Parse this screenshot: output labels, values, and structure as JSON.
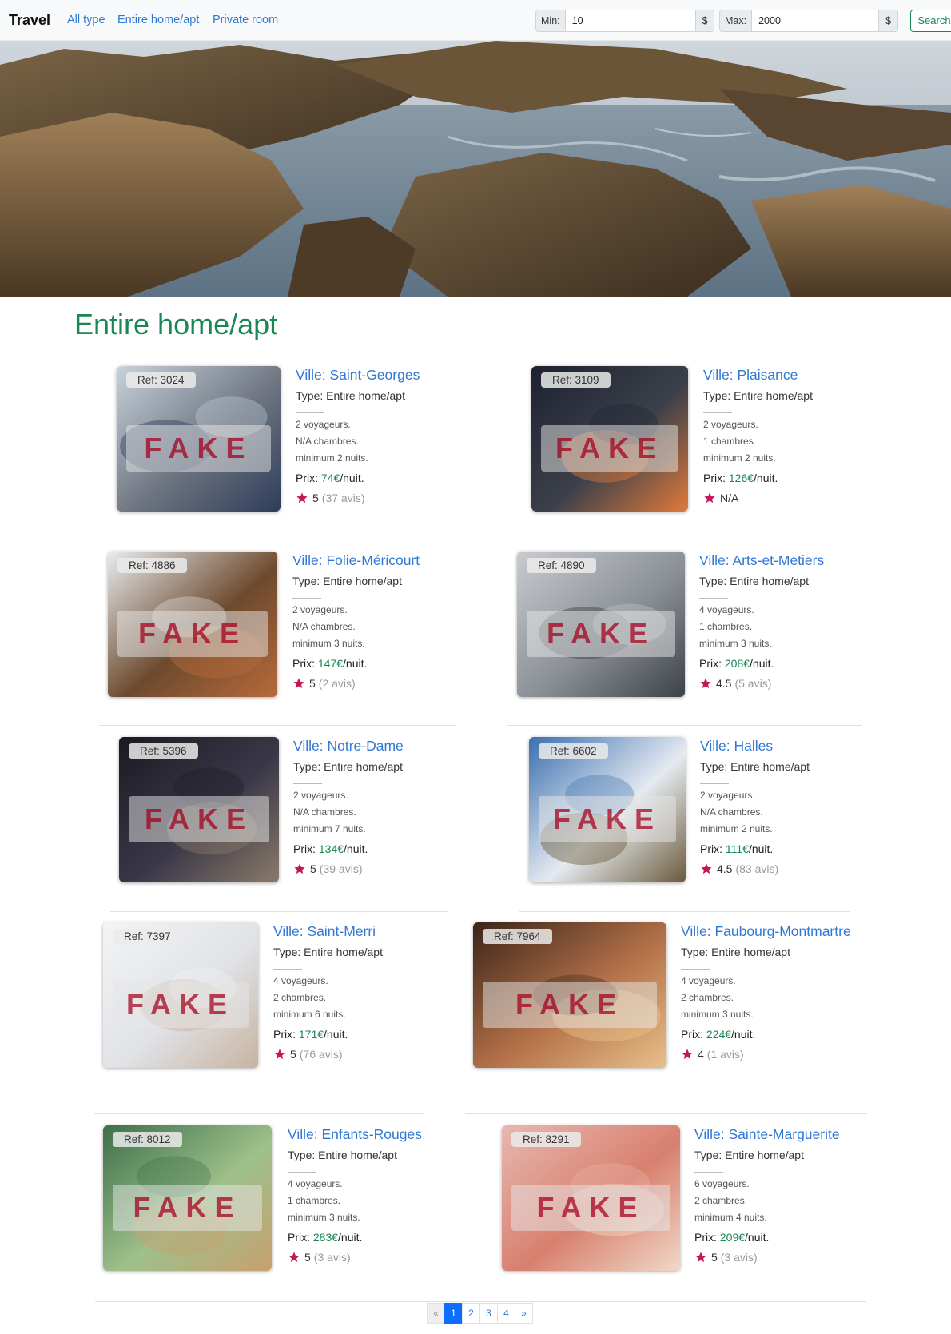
{
  "navbar": {
    "brand": "Travel",
    "links": [
      "All type",
      "Entire home/apt",
      "Private room"
    ],
    "min_label": "Min:",
    "min_value": "10",
    "max_label": "Max:",
    "max_value": "2000",
    "currency": "$",
    "search_label": "Search"
  },
  "section_title": "Entire home/apt",
  "listings": [
    {
      "ref": "Ref: 3024",
      "fake": "FAKE",
      "city": "Ville: Saint-Georges",
      "type": "Type: Entire home/apt",
      "guests": "2 voyageurs.",
      "rooms": "N/A chambres.",
      "nights": "minimum 2 nuits.",
      "price_prefix": "Prix: ",
      "price": "74€",
      "price_suffix": "/nuit.",
      "rating": "5",
      "reviews": "(37 avis)"
    },
    {
      "ref": "Ref: 3109",
      "fake": "FAKE",
      "city": "Ville: Plaisance",
      "type": "Type: Entire home/apt",
      "guests": "2 voyageurs.",
      "rooms": "1 chambres.",
      "nights": "minimum 2 nuits.",
      "price_prefix": "Prix: ",
      "price": "126€",
      "price_suffix": "/nuit.",
      "rating": "N/A",
      "reviews": ""
    },
    {
      "ref": "Ref: 4886",
      "fake": "FAKE",
      "city": "Ville: Folie-Méricourt",
      "type": "Type: Entire home/apt",
      "guests": "2 voyageurs.",
      "rooms": "N/A chambres.",
      "nights": "minimum 3 nuits.",
      "price_prefix": "Prix: ",
      "price": "147€",
      "price_suffix": "/nuit.",
      "rating": "5",
      "reviews": "(2 avis)"
    },
    {
      "ref": "Ref: 4890",
      "fake": "FAKE",
      "city": "Ville: Arts-et-Metiers",
      "type": "Type: Entire home/apt",
      "guests": "4 voyageurs.",
      "rooms": "1 chambres.",
      "nights": "minimum 3 nuits.",
      "price_prefix": "Prix: ",
      "price": "208€",
      "price_suffix": "/nuit.",
      "rating": "4.5",
      "reviews": "(5 avis)"
    },
    {
      "ref": "Ref: 5396",
      "fake": "FAKE",
      "city": "Ville: Notre-Dame",
      "type": "Type: Entire home/apt",
      "guests": "2 voyageurs.",
      "rooms": "N/A chambres.",
      "nights": "minimum 7 nuits.",
      "price_prefix": "Prix: ",
      "price": "134€",
      "price_suffix": "/nuit.",
      "rating": "5",
      "reviews": "(39 avis)"
    },
    {
      "ref": "Ref: 6602",
      "fake": "FAKE",
      "city": "Ville: Halles",
      "type": "Type: Entire home/apt",
      "guests": "2 voyageurs.",
      "rooms": "N/A chambres.",
      "nights": "minimum 2 nuits.",
      "price_prefix": "Prix: ",
      "price": "111€",
      "price_suffix": "/nuit.",
      "rating": "4.5",
      "reviews": "(83 avis)"
    },
    {
      "ref": "Ref: 7397",
      "fake": "FAKE",
      "city": "Ville: Saint-Merri",
      "type": "Type: Entire home/apt",
      "guests": "4 voyageurs.",
      "rooms": "2 chambres.",
      "nights": "minimum 6 nuits.",
      "price_prefix": "Prix: ",
      "price": "171€",
      "price_suffix": "/nuit.",
      "rating": "5",
      "reviews": "(76 avis)"
    },
    {
      "ref": "Ref: 7964",
      "fake": "FAKE",
      "city": "Ville: Faubourg-Montmartre",
      "type": "Type: Entire home/apt",
      "guests": "4 voyageurs.",
      "rooms": "2 chambres.",
      "nights": "minimum 3 nuits.",
      "price_prefix": "Prix: ",
      "price": "224€",
      "price_suffix": "/nuit.",
      "rating": "4",
      "reviews": "(1 avis)"
    },
    {
      "ref": "Ref: 8012",
      "fake": "FAKE",
      "city": "Ville: Enfants-Rouges",
      "type": "Type: Entire home/apt",
      "guests": "4 voyageurs.",
      "rooms": "1 chambres.",
      "nights": "minimum 3 nuits.",
      "price_prefix": "Prix: ",
      "price": "283€",
      "price_suffix": "/nuit.",
      "rating": "5",
      "reviews": "(3 avis)"
    },
    {
      "ref": "Ref: 8291",
      "fake": "FAKE",
      "city": "Ville: Sainte-Marguerite",
      "type": "Type: Entire home/apt",
      "guests": "6 voyageurs.",
      "rooms": "2 chambres.",
      "nights": "minimum 4 nuits.",
      "price_prefix": "Prix: ",
      "price": "209€",
      "price_suffix": "/nuit.",
      "rating": "5",
      "reviews": "(3 avis)"
    }
  ],
  "pagination": {
    "prev": "«",
    "pages": [
      "1",
      "2",
      "3",
      "4"
    ],
    "next": "»",
    "active": "1"
  },
  "colors": {
    "accent_green": "#198754",
    "link_blue": "#2f78d6",
    "star": "#c2185b",
    "fake_text": "#b0223b"
  }
}
